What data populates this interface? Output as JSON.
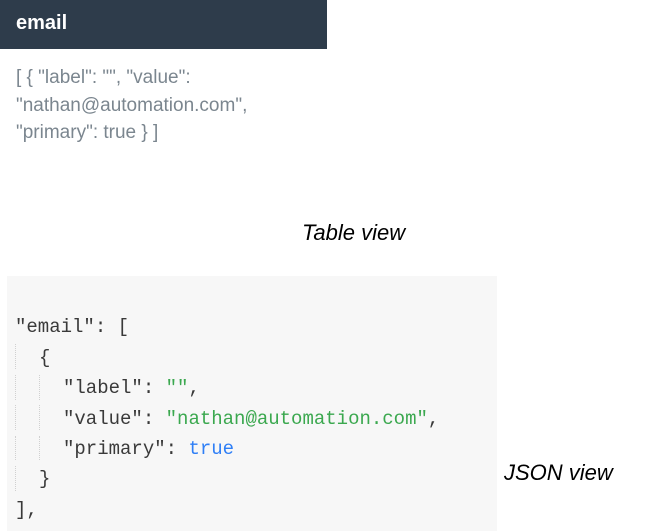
{
  "table": {
    "header": "email",
    "cell_text": "[ { \"label\": \"\", \"value\": \"nathan@automation.com\", \"primary\": true } ]"
  },
  "captions": {
    "table": "Table view",
    "json": "JSON view"
  },
  "json": {
    "key": "\"email\"",
    "colon_open": ": [",
    "brace_open": "{",
    "label_key": "\"label\"",
    "label_val": "\"\"",
    "value_key": "\"value\"",
    "value_val": "\"nathan@automation.com\"",
    "primary_key": "\"primary\"",
    "primary_val": "true",
    "brace_close": "}",
    "bracket_close": "],",
    "sep": ": ",
    "comma": ","
  }
}
